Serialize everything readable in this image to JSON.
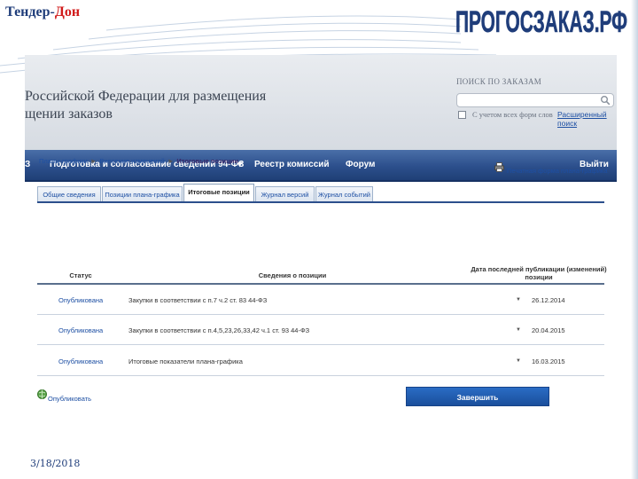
{
  "slide": {
    "brand_part1": "Тендер-",
    "brand_part2": "Дон",
    "logo_text": "ПРОГОСЗАКАЗ.РФ",
    "date": "3/18/2018"
  },
  "header": {
    "title_line1": "Российской Федерации для размещения",
    "title_line2": "щении заказов",
    "search_label": "ПОИСК ПО ЗАКАЗАМ",
    "search_placeholder": "",
    "checkbox_label": "С учетом всех форм слов",
    "advanced_link": "Расширенный поиск"
  },
  "nav": {
    "items": [
      {
        "label": "З"
      },
      {
        "label": "Подготовка и согласование сведений 94-ФЗ"
      },
      {
        "label": "Реестр комиссий"
      },
      {
        "label": "Форум"
      },
      {
        "label": "Выйти"
      }
    ],
    "dropdown_glyph": "▾"
  },
  "breadcrumb": {
    "items": [
      "Планы-графики",
      "Внесение изменений",
      "Итоговые позиции"
    ],
    "separator": "►"
  },
  "print_link": "Печатная форма плана-графика",
  "tabs": [
    {
      "label": "Общие сведения"
    },
    {
      "label": "Позиции плана-графика"
    },
    {
      "label": "Итоговые позиции"
    },
    {
      "label": "Журнал версий"
    },
    {
      "label": "Журнал событий"
    }
  ],
  "table": {
    "headers": {
      "status": "Статус",
      "info": "Сведения о позиции",
      "date_line1": "Дата последней публикации (изменений)",
      "date_line2": "позиции"
    },
    "rows": [
      {
        "status": "Опубликована",
        "info": "Закупки в соответствии с п.7 ч.2 ст. 83 44-ФЗ",
        "date": "26.12.2014"
      },
      {
        "status": "Опубликована",
        "info": "Закупки в соответствии с п.4,5,23,26,33,42 ч.1 ст. 93 44-ФЗ",
        "date": "20.04.2015"
      },
      {
        "status": "Опубликована",
        "info": "Итоговые показатели плана-графика",
        "date": "16.03.2015"
      }
    ],
    "arrow_glyph": "▼"
  },
  "actions": {
    "publish_label": "Опубликовать",
    "finish_label": "Завершить"
  },
  "colors": {
    "nav_bar": "#2c4f8c",
    "link": "#1d4fa3",
    "brand_red": "#d01a1a",
    "brand_blue": "#1f3d7a",
    "button": "#1a4f9c"
  }
}
